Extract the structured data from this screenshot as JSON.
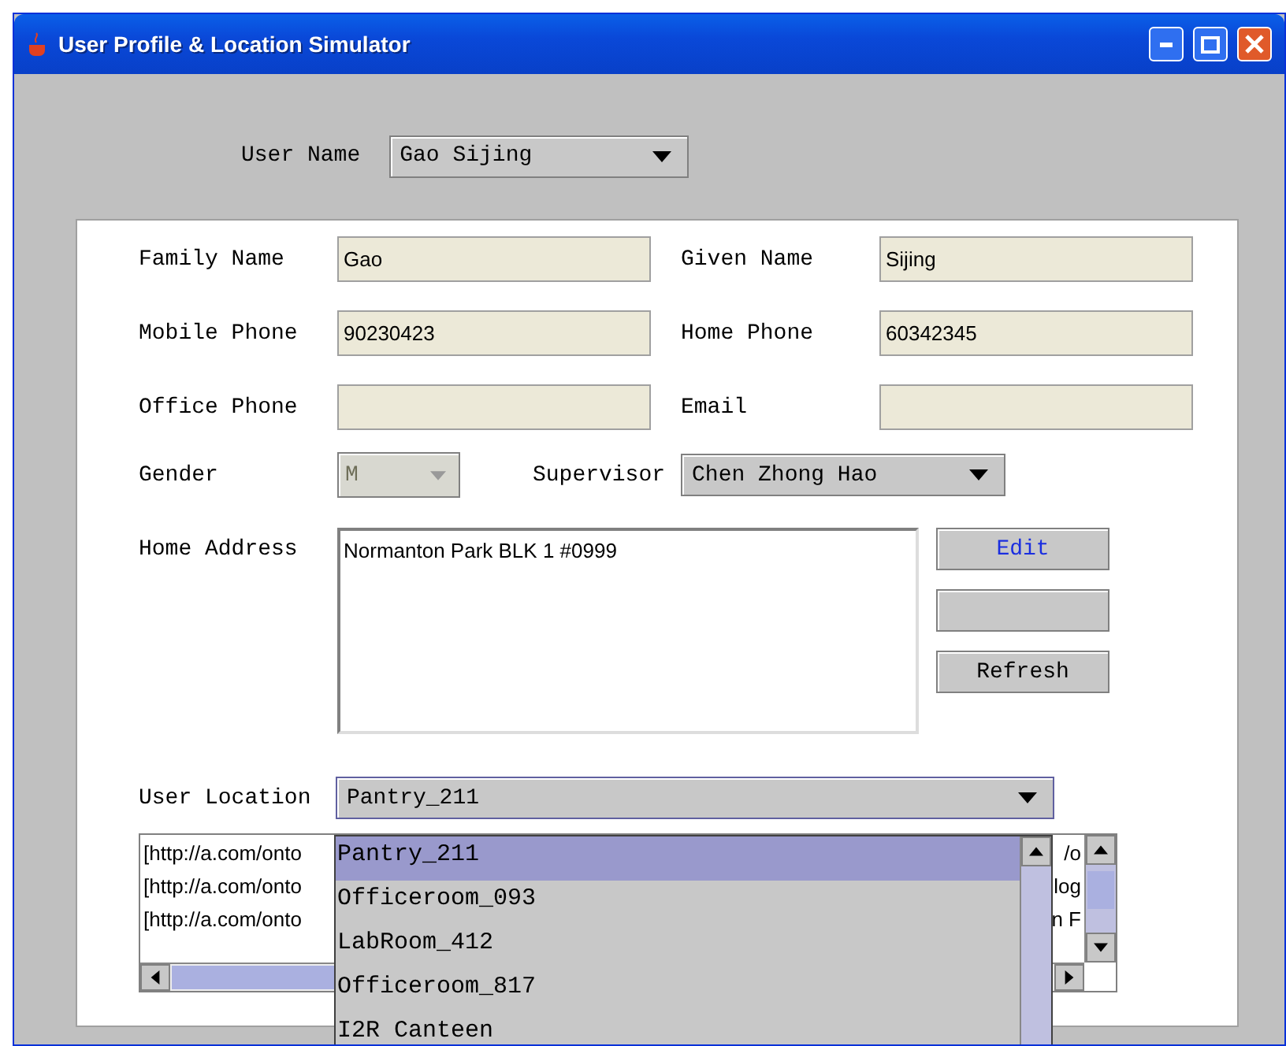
{
  "window": {
    "title": "User Profile & Location Simulator"
  },
  "user_name": {
    "label": "User Name",
    "value": "Gao Sijing"
  },
  "fields": [
    {
      "label": "Family Name",
      "value": "Gao"
    },
    {
      "label": "Given Name",
      "value": "Sijing"
    },
    {
      "label": "Mobile Phone",
      "value": "90230423"
    },
    {
      "label": "Home Phone",
      "value": "60342345"
    },
    {
      "label": "Office Phone"
    },
    {
      "label": "Email"
    }
  ],
  "gender": {
    "label": "Gender",
    "value": "M",
    "disabled": true
  },
  "supervisor": {
    "label": "Supervisor",
    "value": "Chen Zhong Hao"
  },
  "home_address": {
    "label": "Home Address",
    "value": "Normanton Park BLK 1 #0999"
  },
  "buttons": [
    {
      "label": "Edit",
      "kind": "link"
    },
    {
      "kind": "plain"
    },
    {
      "label": "Refresh",
      "kind": "plain"
    }
  ],
  "user_location": {
    "label": "User Location",
    "value": "Pantry_211",
    "expanded": true,
    "options": [
      {
        "label": "Pantry_211",
        "selected": true
      },
      {
        "label": "Officeroom_093",
        "selected": false
      },
      {
        "label": "LabRoom_412",
        "selected": false
      },
      {
        "label": "Officeroom_817",
        "selected": false
      },
      {
        "label": "I2R Canteen",
        "selected": false
      }
    ]
  },
  "log": [
    {
      "left": "[http://a.com/onto",
      "right": "/o"
    },
    {
      "left": "[http://a.com/onto",
      "right": "log"
    },
    {
      "left": "[http://a.com/onto",
      "right": "n F"
    }
  ]
}
